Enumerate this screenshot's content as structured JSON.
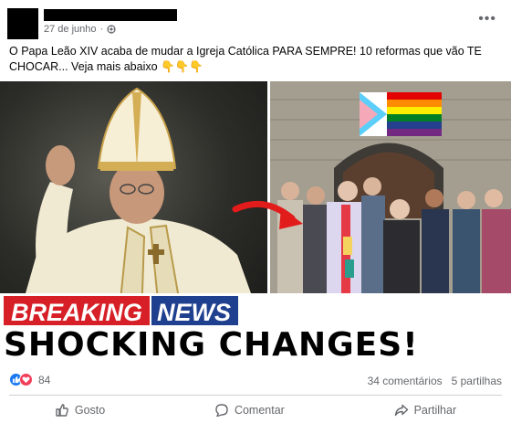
{
  "post": {
    "date": "27 de junho",
    "separator": "·",
    "text": "O Papa Leão XIV acaba de mudar a Igreja Católica PARA SEMPRE! 10 reformas que vão TE CHOCAR... Veja mais abaixo 👇👇👇",
    "more_icon": "more-options-icon"
  },
  "image": {
    "banner_word_1": "BREAKING",
    "banner_word_2": "NEWS",
    "headline": "SHOCKING CHANGES!"
  },
  "stats": {
    "reaction_count": "84",
    "comments": "34 comentários",
    "shares": "5 partilhas"
  },
  "actions": {
    "like": "Gosto",
    "comment": "Comentar",
    "share": "Partilhar"
  },
  "colors": {
    "breaking_red": "#d61f26",
    "news_blue": "#1f3f8f",
    "like_blue": "#1877f2",
    "love_red": "#f33e58"
  }
}
